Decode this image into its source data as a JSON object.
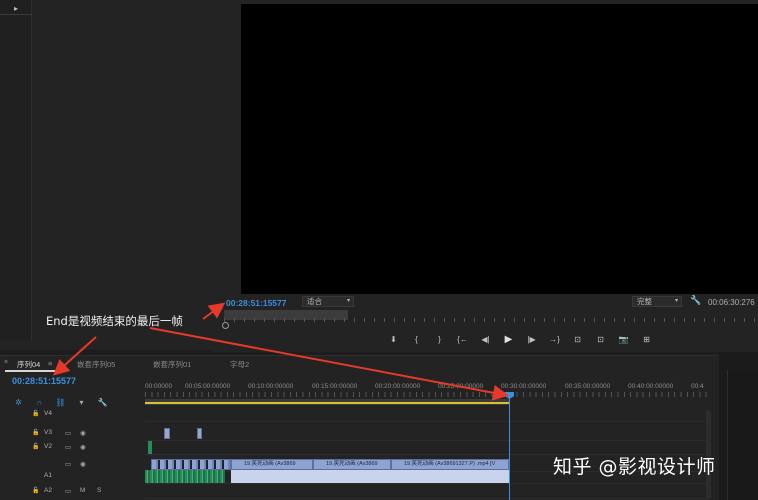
{
  "left_panel": {
    "menu_icon": "play-triangle-icon"
  },
  "monitor": {
    "timecode": "00:28:51:15577",
    "fit_label": "适合",
    "quality_label": "完整",
    "duration": "00:06:30:276",
    "transport": [
      "⬇",
      "{",
      "}",
      "{←",
      "◀|",
      "▶",
      "|▶",
      "→}",
      "⊡",
      "⊡",
      "📷",
      "⊞"
    ]
  },
  "annotation": {
    "text": "End是视频结束的最后一帧"
  },
  "timeline": {
    "tabs": [
      "序列04",
      "嵌套序列05",
      "嵌套序列01",
      "字母2"
    ],
    "tab_menu": "≡",
    "timecode": "00:28:51:15577",
    "ruler_labels": [
      "00:00000",
      "00:05:00:00000",
      "00:10:00:00000",
      "00:15:00:00000",
      "00:20:00:00000",
      "00:25:00:00000",
      "00:30:00:00000",
      "00:35:00:00000",
      "00:40:00:00000",
      "00:4"
    ],
    "tracks": [
      {
        "name": "V4"
      },
      {
        "name": "V3"
      },
      {
        "name": "V2"
      },
      {
        "name": ""
      },
      {
        "name": "A1",
        "m": "M",
        "s": "S"
      },
      {
        "name": "A2",
        "m": "M",
        "s": "S"
      }
    ],
    "clips": [
      "19.笑死动画 (Av3869",
      "19.笑死动画 (Av3869",
      "19.笑死动画 (Av38691327.P) .mp4 [V"
    ]
  },
  "watermark": {
    "text": "知乎 @影视设计师"
  }
}
